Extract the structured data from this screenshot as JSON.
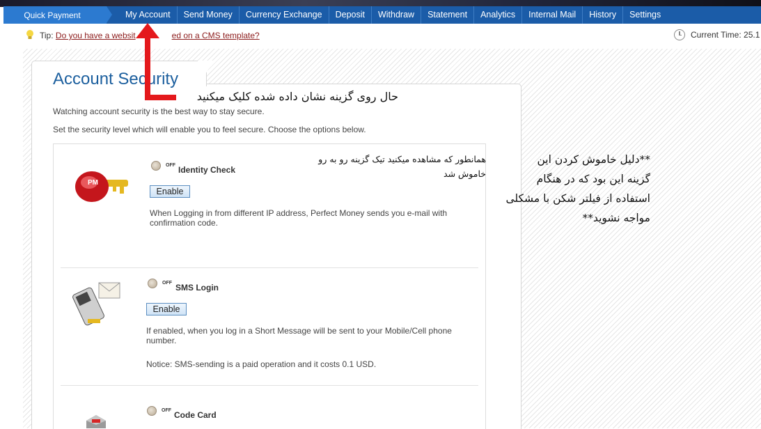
{
  "nav": {
    "quick_payment": "Quick Payment",
    "items": [
      "My Account",
      "Send Money",
      "Currency Exchange",
      "Deposit",
      "Withdraw",
      "Statement",
      "Analytics",
      "Internal Mail",
      "History",
      "Settings"
    ]
  },
  "tip": {
    "prefix": "Tip:",
    "link_start": "Do you have a websit",
    "link_end": "ed on a CMS template?"
  },
  "clock": {
    "label": "Current Time: 25.1"
  },
  "page": {
    "title": "Account Security",
    "intro": "Watching account security is the best way to stay secure.",
    "instruction": "Set the security level which will enable you to feel secure. Choose the options below."
  },
  "options": [
    {
      "toggle_state": "OFF",
      "name": "Identity Check",
      "button": "Enable",
      "description": "When Logging in from different IP address, Perfect Money sends you e-mail with confirmation code.",
      "icon": "pm-key-icon"
    },
    {
      "toggle_state": "OFF",
      "name": "SMS Login",
      "button": "Enable",
      "description": "If enabled, when you log in a Short Message will be sent to your Mobile/Cell phone number.",
      "notice": "Notice: SMS-sending is a paid operation and it costs 0.1 USD.",
      "icon": "phone-envelope-icon"
    },
    {
      "toggle_state": "OFF",
      "name": "Code Card",
      "icon": "code-card-icon"
    }
  ],
  "annotations": {
    "click_note": "حال روی گزینه نشان داده شده کلیک میکنید",
    "off_note_line1": "همانطور که مشاهده میکنید تیک گزینه رو به رو",
    "off_note_line2": "خاموش شد",
    "reason_line1": "**دلیل خاموش کردن این",
    "reason_line2": "گزینه این بود که در هنگام",
    "reason_line3": "استفاده از فیلتر شکن با مشکلی",
    "reason_line4": "مواجه نشوید**",
    "arrow_color": "#e4191c"
  }
}
